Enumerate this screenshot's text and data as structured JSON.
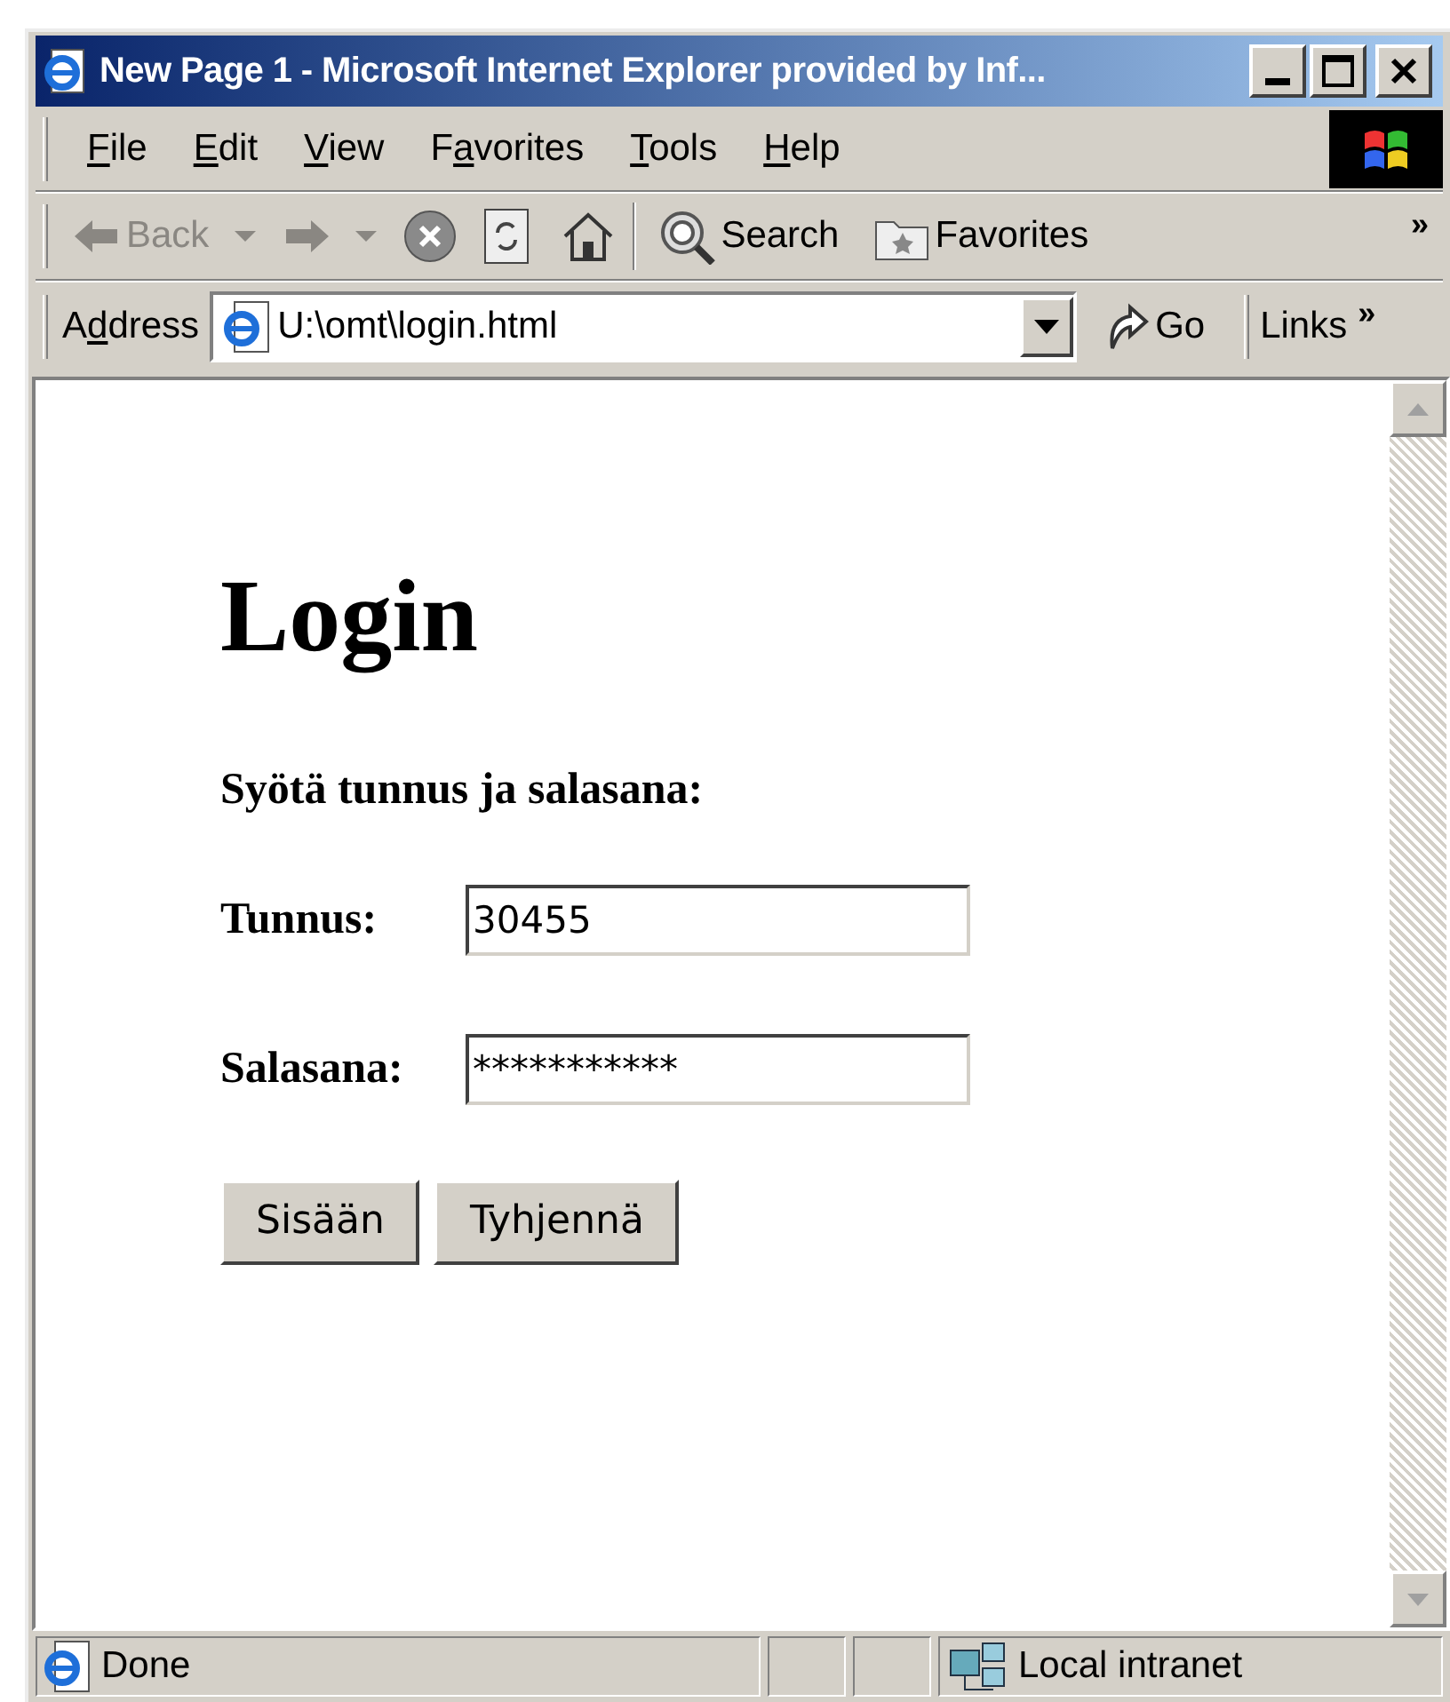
{
  "window": {
    "title": "New Page 1 - Microsoft Internet Explorer provided by Inf..."
  },
  "menu": [
    {
      "key": "F",
      "post": "ile"
    },
    {
      "key": "E",
      "post": "dit"
    },
    {
      "key": "V",
      "post": "iew"
    },
    {
      "pre": "F",
      "key": "a",
      "post": "vorites"
    },
    {
      "key": "T",
      "post": "ools"
    },
    {
      "key": "H",
      "post": "elp"
    }
  ],
  "toolbar": {
    "back": "Back",
    "search": "Search",
    "favorites": "Favorites",
    "more": "»"
  },
  "address_bar": {
    "label": {
      "pre": "A",
      "key": "d",
      "post": "dress"
    },
    "value": "U:\\omt\\login.html",
    "go": "Go",
    "links": "Links",
    "more": "»"
  },
  "page": {
    "heading": "Login",
    "instruction": "Syötä tunnus ja salasana:",
    "fields": [
      {
        "label": "Tunnus:",
        "value": "30455"
      },
      {
        "label": "Salasana:",
        "value": "***********"
      }
    ],
    "buttons": [
      "Sisään",
      "Tyhjennä"
    ]
  },
  "status_bar": {
    "text": "Done",
    "zone": "Local intranet"
  }
}
